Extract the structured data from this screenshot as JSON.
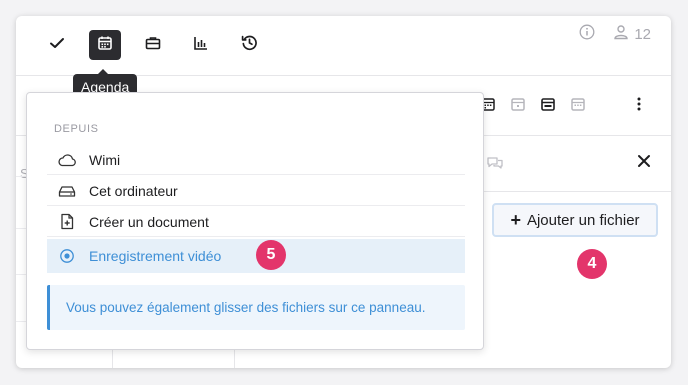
{
  "toolbar": {
    "buttons": [
      {
        "name": "check",
        "icon": "check-icon"
      },
      {
        "name": "agenda",
        "icon": "calendar-icon",
        "active": true
      },
      {
        "name": "briefcase",
        "icon": "briefcase-icon"
      },
      {
        "name": "chart",
        "icon": "bar-chart-icon"
      },
      {
        "name": "history",
        "icon": "history-icon"
      }
    ],
    "tooltip": "Agenda",
    "user_count": "12"
  },
  "left_peek": "S",
  "dropdown": {
    "header": "DEPUIS",
    "items": [
      {
        "label": "Wimi",
        "icon": "cloud-icon"
      },
      {
        "label": "Cet ordinateur",
        "icon": "hard-drive-icon"
      },
      {
        "label": "Créer un document",
        "icon": "new-document-icon"
      },
      {
        "label": "Enregistrement vidéo",
        "icon": "record-icon",
        "selected": true
      }
    ],
    "info": "Vous pouvez également glisser des fichiers sur ce panneau."
  },
  "panel": {
    "add_file_label": "Ajouter un fichier"
  },
  "badges": {
    "step4": "4",
    "step5": "5"
  },
  "colors": {
    "accent": "#3e8fd6",
    "badge": "#e3356b",
    "dark": "#2c2c30"
  }
}
